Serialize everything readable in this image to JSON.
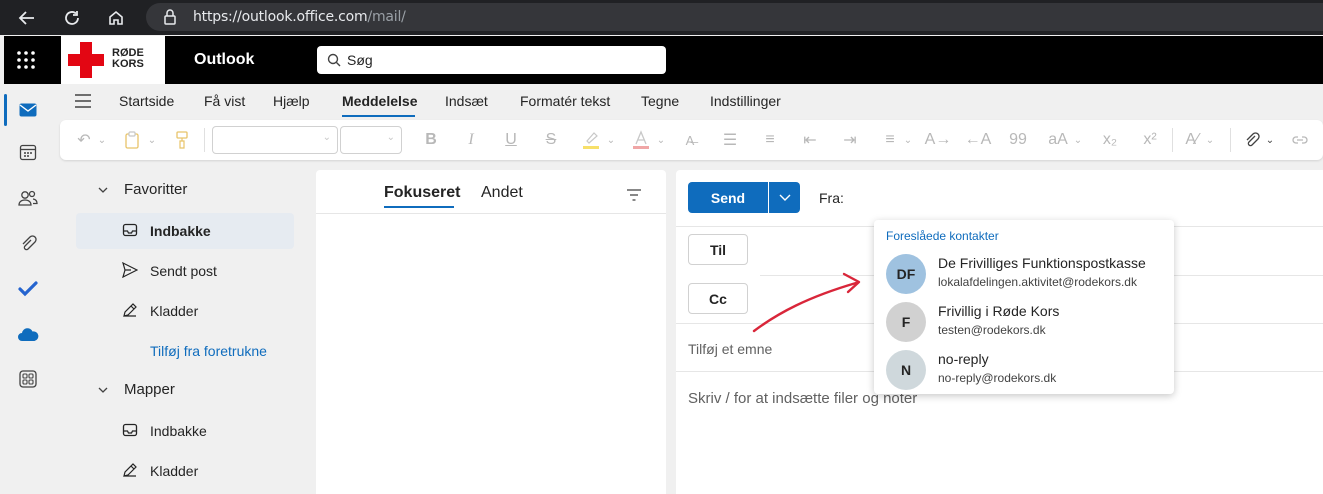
{
  "browser": {
    "url_main": "https://outlook.office.com",
    "url_path": "/mail/"
  },
  "header": {
    "logo_text_line1": "RØDE",
    "logo_text_line2": "KORS",
    "app_name": "Outlook",
    "search_placeholder": "Søg"
  },
  "ribbon": {
    "tabs": [
      "Startside",
      "Få vist",
      "Hjælp",
      "Meddelelse",
      "Indsæt",
      "Formatér tekst",
      "Tegne",
      "Indstillinger"
    ],
    "active_tab": "Meddelelse"
  },
  "folders": {
    "favorites_label": "Favoritter",
    "favorites": [
      "Indbakke",
      "Sendt post",
      "Kladder"
    ],
    "add_favorite": "Tilføj fra foretrukne",
    "folders_label": "Mapper",
    "folder_items": [
      "Indbakke",
      "Kladder"
    ]
  },
  "message_list": {
    "tab_focused": "Fokuseret",
    "tab_other": "Andet"
  },
  "compose": {
    "send_label": "Send",
    "from_label": "Fra:",
    "to_label": "Til",
    "cc_label": "Cc",
    "subject_placeholder": "Tilføj et emne",
    "body_placeholder": "Skriv / for at indsætte filer og noter"
  },
  "suggestions": {
    "title": "Foreslåede kontakter",
    "contacts": [
      {
        "initials": "DF",
        "name": "De Frivilliges Funktionspostkasse",
        "email": "lokalafdelingen.aktivitet@rodekors.dk",
        "avatar_color": "#9fc2e0"
      },
      {
        "initials": "F",
        "name": "Frivillig i Røde Kors",
        "email": "testen@rodekors.dk",
        "avatar_color": "#d1d1d1"
      },
      {
        "initials": "N",
        "name": "no-reply",
        "email": "no-reply@rodekors.dk",
        "avatar_color": "#cfd8dc"
      }
    ]
  },
  "colors": {
    "accent": "#0f6cbd",
    "annotation_arrow": "#d9263a",
    "brand_red": "#e30613"
  }
}
